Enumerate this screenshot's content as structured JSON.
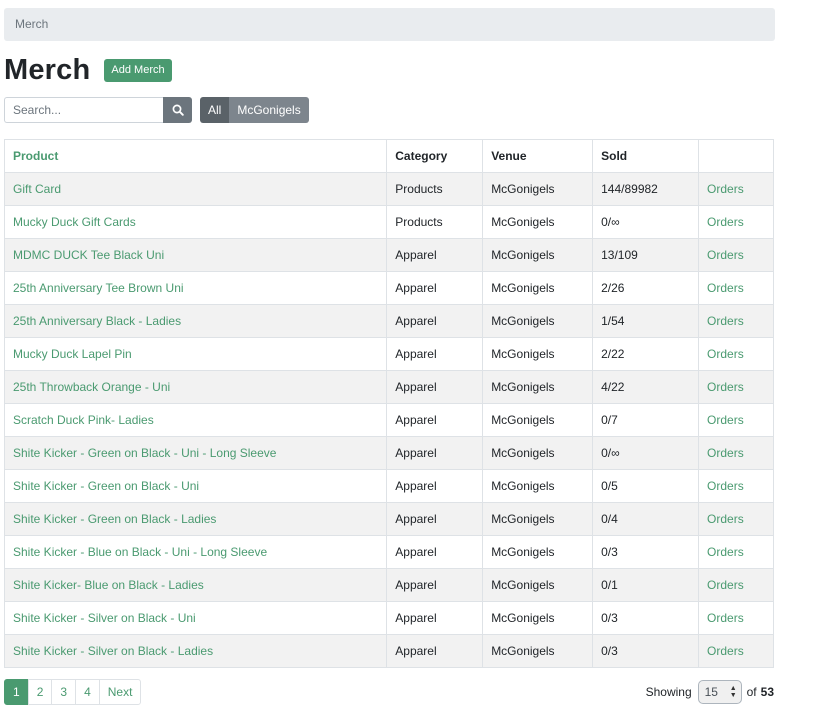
{
  "breadcrumb": {
    "label": "Merch"
  },
  "header": {
    "title": "Merch",
    "add_label": "Add Merch"
  },
  "search": {
    "placeholder": "Search...",
    "value": ""
  },
  "filters": {
    "all_label": "All",
    "venue_label": "McGonigels"
  },
  "table": {
    "headers": {
      "product": "Product",
      "category": "Category",
      "venue": "Venue",
      "sold": "Sold",
      "actions": ""
    },
    "rows": [
      {
        "product": "Gift Card",
        "category": "Products",
        "venue": "McGonigels",
        "sold": "144/89982",
        "action": "Orders"
      },
      {
        "product": "Mucky Duck Gift Cards",
        "category": "Products",
        "venue": "McGonigels",
        "sold": "0/∞",
        "action": "Orders"
      },
      {
        "product": "MDMC DUCK Tee Black Uni",
        "category": "Apparel",
        "venue": "McGonigels",
        "sold": "13/109",
        "action": "Orders"
      },
      {
        "product": "25th Anniversary Tee Brown Uni",
        "category": "Apparel",
        "venue": "McGonigels",
        "sold": "2/26",
        "action": "Orders"
      },
      {
        "product": "25th Anniversary Black - Ladies",
        "category": "Apparel",
        "venue": "McGonigels",
        "sold": "1/54",
        "action": "Orders"
      },
      {
        "product": "Mucky Duck Lapel Pin",
        "category": "Apparel",
        "venue": "McGonigels",
        "sold": "2/22",
        "action": "Orders"
      },
      {
        "product": "25th Throwback Orange - Uni",
        "category": "Apparel",
        "venue": "McGonigels",
        "sold": "4/22",
        "action": "Orders"
      },
      {
        "product": "Scratch Duck Pink- Ladies",
        "category": "Apparel",
        "venue": "McGonigels",
        "sold": "0/7",
        "action": "Orders"
      },
      {
        "product": "Shite Kicker - Green on Black - Uni - Long Sleeve",
        "category": "Apparel",
        "venue": "McGonigels",
        "sold": "0/∞",
        "action": "Orders"
      },
      {
        "product": "Shite Kicker - Green on Black - Uni",
        "category": "Apparel",
        "venue": "McGonigels",
        "sold": "0/5",
        "action": "Orders"
      },
      {
        "product": "Shite Kicker - Green on Black - Ladies",
        "category": "Apparel",
        "venue": "McGonigels",
        "sold": "0/4",
        "action": "Orders"
      },
      {
        "product": "Shite Kicker - Blue on Black - Uni - Long Sleeve",
        "category": "Apparel",
        "venue": "McGonigels",
        "sold": "0/3",
        "action": "Orders"
      },
      {
        "product": "Shite Kicker- Blue on Black - Ladies",
        "category": "Apparel",
        "venue": "McGonigels",
        "sold": "0/1",
        "action": "Orders"
      },
      {
        "product": "Shite Kicker - Silver on Black - Uni",
        "category": "Apparel",
        "venue": "McGonigels",
        "sold": "0/3",
        "action": "Orders"
      },
      {
        "product": "Shite Kicker - Silver on Black - Ladies",
        "category": "Apparel",
        "venue": "McGonigels",
        "sold": "0/3",
        "action": "Orders"
      }
    ]
  },
  "pagination": {
    "pages": [
      "1",
      "2",
      "3",
      "4"
    ],
    "active_page": "1",
    "next_label": "Next"
  },
  "showing": {
    "label": "Showing",
    "per_page": "15",
    "of_label": "of",
    "total": "53"
  },
  "colors": {
    "accent": "#4a9a70",
    "secondary": "#6c757d",
    "stripe": "#f2f2f2"
  },
  "icons": {
    "search": "search-icon",
    "per_page_arrows": "chevron-updown-icon"
  }
}
